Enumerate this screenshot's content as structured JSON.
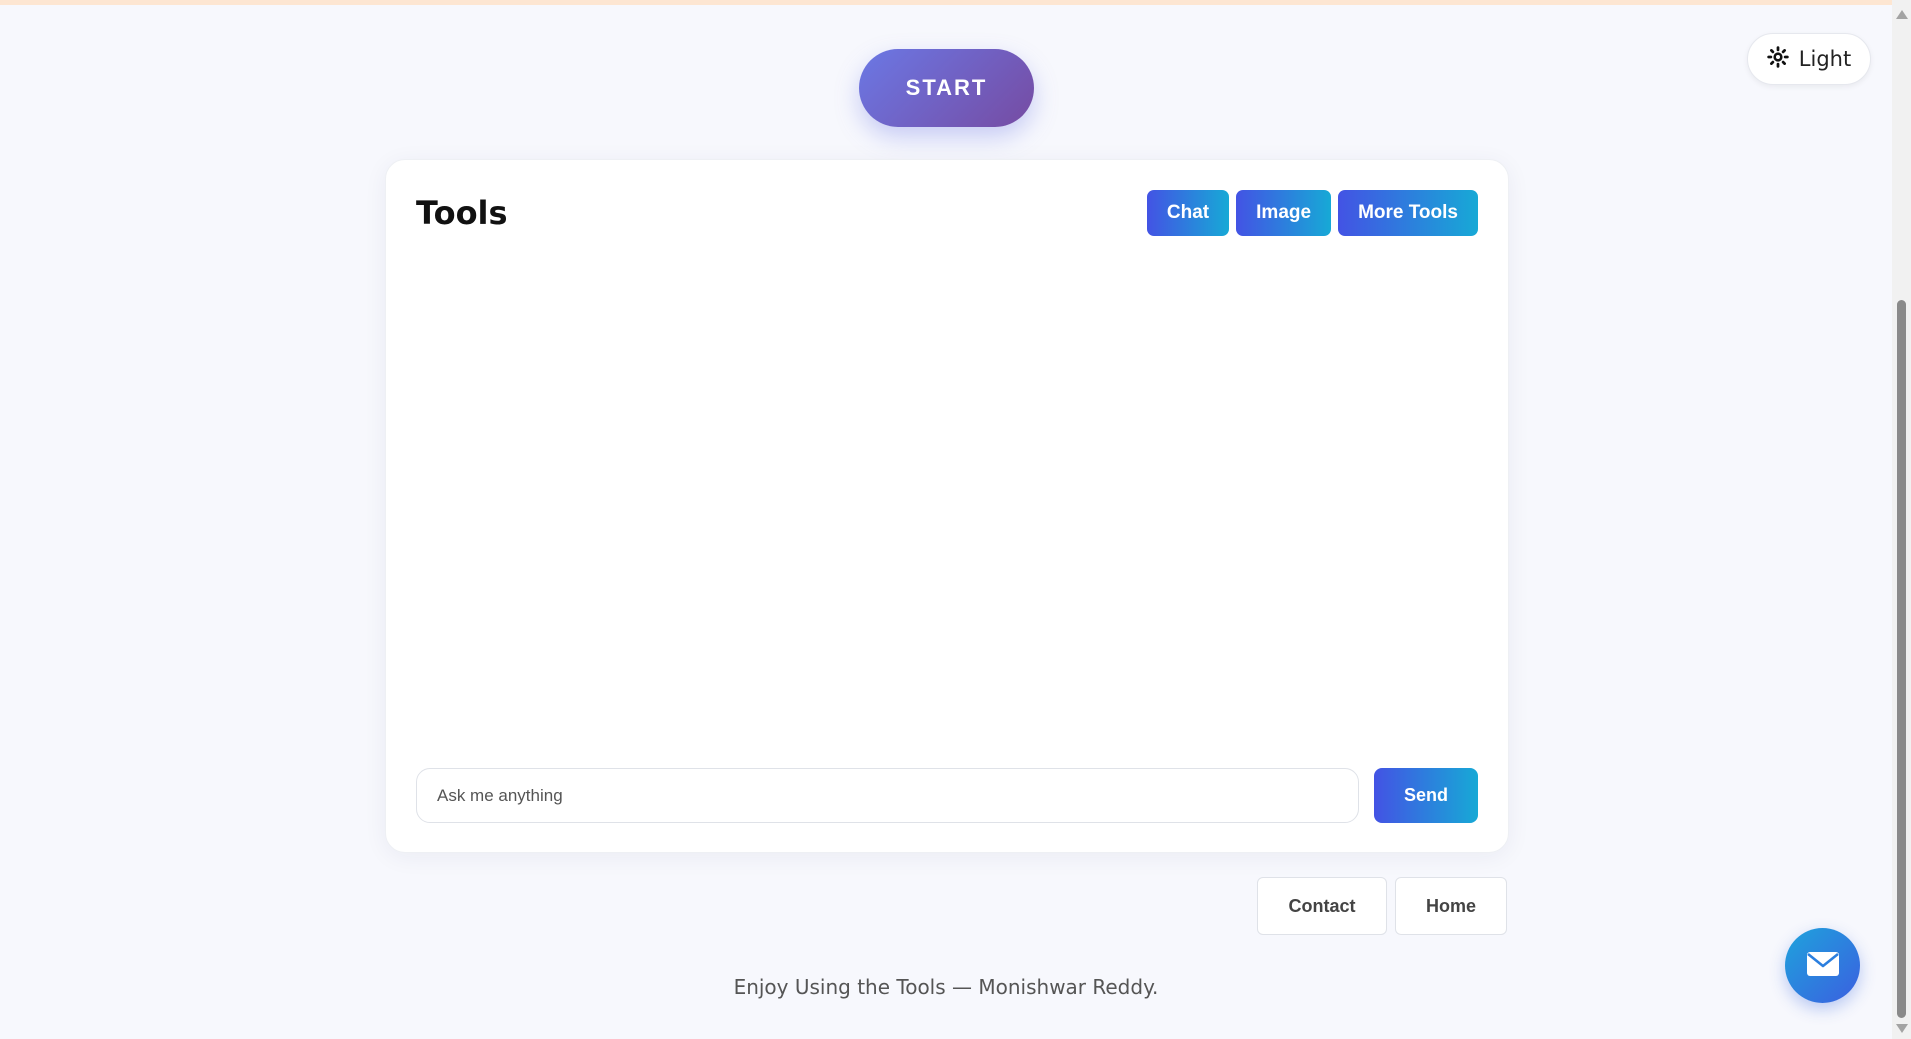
{
  "start_button": {
    "label": "START"
  },
  "theme_toggle": {
    "label": "Light",
    "icon": "sun-icon"
  },
  "card": {
    "title": "Tools",
    "tabs": [
      {
        "label": "Chat"
      },
      {
        "label": "Image"
      },
      {
        "label": "More Tools"
      }
    ],
    "input": {
      "placeholder": "Ask me anything",
      "value": ""
    },
    "send_label": "Send"
  },
  "footer": {
    "links": [
      {
        "label": "Contact"
      },
      {
        "label": "Home"
      }
    ],
    "text": "Enjoy Using the Tools — Monishwar Reddy."
  },
  "fab": {
    "icon": "envelope-icon"
  },
  "colors": {
    "start_gradient": [
      "#6b78e5",
      "#764ba2"
    ],
    "button_gradient": [
      "#4353e4",
      "#17a9d6"
    ],
    "background": "#f7f8fd"
  }
}
